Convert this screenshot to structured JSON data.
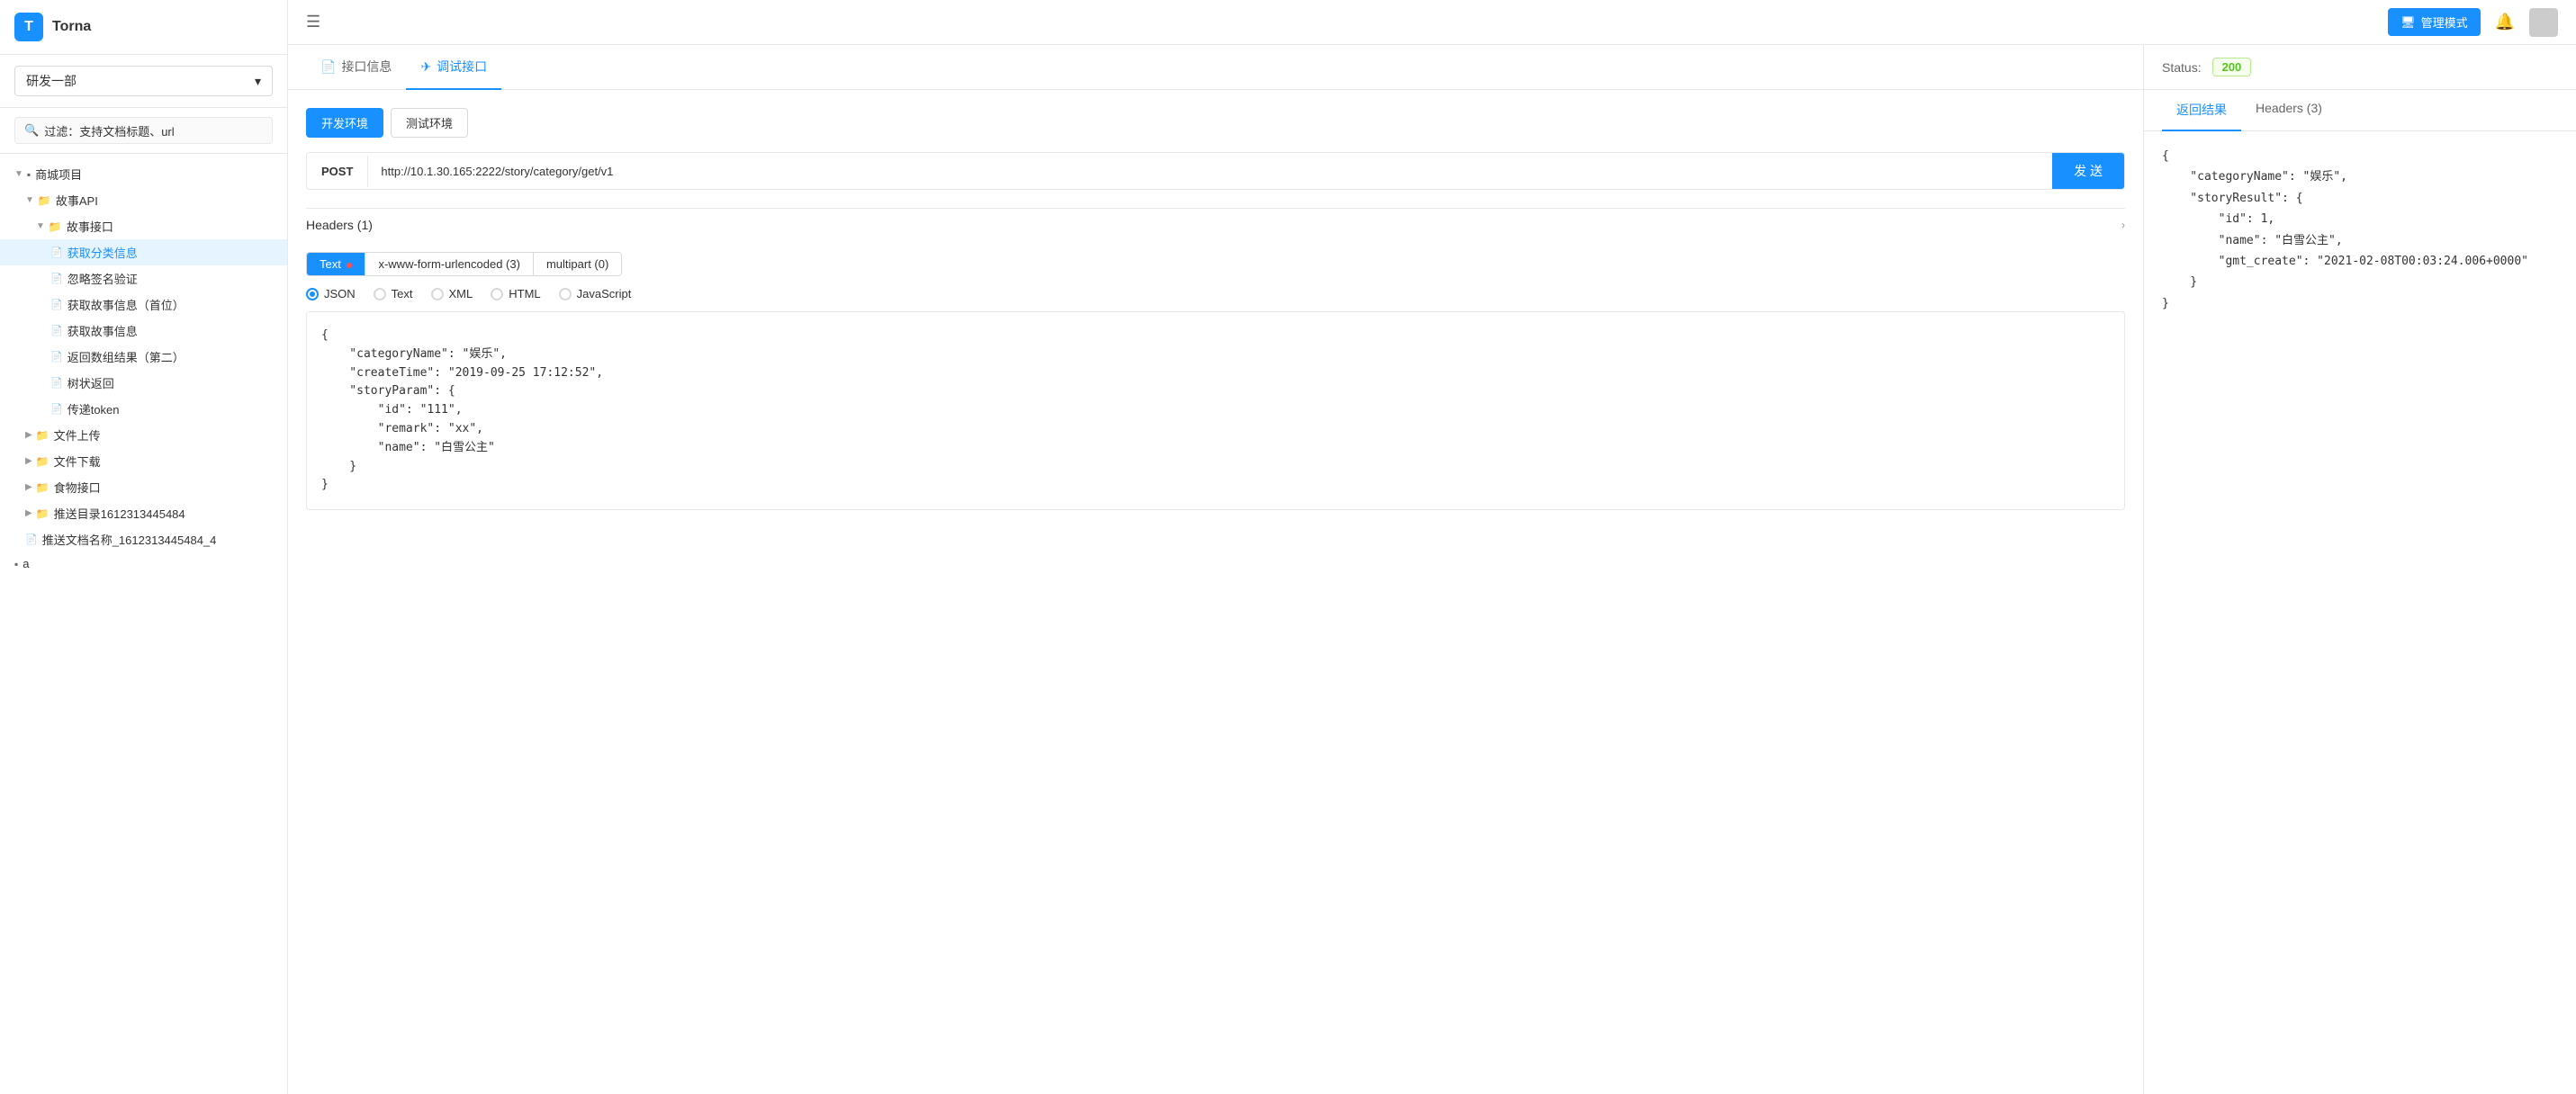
{
  "app": {
    "name": "Torna",
    "logo": "T"
  },
  "sidebar": {
    "dept": "研发一部",
    "search_placeholder": "过滤：支持文档标题、url",
    "tree": [
      {
        "id": "mall",
        "label": "商城项目",
        "level": 0,
        "type": "project",
        "expanded": true,
        "arrow": "▼"
      },
      {
        "id": "story-api",
        "label": "故事API",
        "level": 1,
        "type": "group",
        "expanded": true,
        "arrow": "▼"
      },
      {
        "id": "story-interface",
        "label": "故事接口",
        "level": 2,
        "type": "folder",
        "expanded": true,
        "arrow": "▼"
      },
      {
        "id": "get-category",
        "label": "获取分类信息",
        "level": 3,
        "type": "file",
        "active": true
      },
      {
        "id": "ignore-sign",
        "label": "忽略签名验证",
        "level": 3,
        "type": "file"
      },
      {
        "id": "get-story-first",
        "label": "获取故事信息（首位）",
        "level": 3,
        "type": "file"
      },
      {
        "id": "get-story",
        "label": "获取故事信息",
        "level": 3,
        "type": "file"
      },
      {
        "id": "return-multi",
        "label": "返回数组结果（第二）",
        "level": 3,
        "type": "file"
      },
      {
        "id": "tree-return",
        "label": "树状返回",
        "level": 3,
        "type": "file"
      },
      {
        "id": "pass-token",
        "label": "传递token",
        "level": 3,
        "type": "file"
      },
      {
        "id": "file-upload",
        "label": "文件上传",
        "level": 1,
        "type": "folder",
        "arrow": "▶"
      },
      {
        "id": "file-download",
        "label": "文件下载",
        "level": 1,
        "type": "folder",
        "arrow": "▶"
      },
      {
        "id": "food-interface",
        "label": "食物接口",
        "level": 1,
        "type": "folder",
        "arrow": "▶"
      },
      {
        "id": "push-dir",
        "label": "推送目录1612313445484",
        "level": 1,
        "type": "folder",
        "arrow": "▶"
      },
      {
        "id": "push-doc",
        "label": "推送文档名称_1612313445484_4",
        "level": 1,
        "type": "file"
      },
      {
        "id": "a",
        "label": "a",
        "level": 0,
        "type": "group"
      }
    ]
  },
  "topbar": {
    "mgmt_btn": "管理模式"
  },
  "tabs": [
    {
      "id": "info",
      "label": "接口信息",
      "icon": "📄"
    },
    {
      "id": "debug",
      "label": "调试接口",
      "icon": "✈",
      "active": true
    }
  ],
  "env_buttons": [
    {
      "id": "dev",
      "label": "开发环境",
      "active": true
    },
    {
      "id": "test",
      "label": "测试环境",
      "active": false
    }
  ],
  "request": {
    "method": "POST",
    "url": "http://10.1.30.165:2222/story/category/get/v1",
    "send_btn": "发 送"
  },
  "headers_section": {
    "title": "Headers (1)"
  },
  "body_section": {
    "tabs": [
      {
        "id": "text",
        "label": "Text",
        "active": true,
        "dot": true
      },
      {
        "id": "form",
        "label": "x-www-form-urlencoded (3)"
      },
      {
        "id": "multipart",
        "label": "multipart (0)"
      }
    ],
    "formats": [
      {
        "id": "json",
        "label": "JSON",
        "checked": true
      },
      {
        "id": "text",
        "label": "Text"
      },
      {
        "id": "xml",
        "label": "XML"
      },
      {
        "id": "html",
        "label": "HTML"
      },
      {
        "id": "js",
        "label": "JavaScript"
      }
    ],
    "code": "{\n    \"categoryName\": \"娱乐\",\n    \"createTime\": \"2019-09-25 17:12:52\",\n    \"storyParam\": {\n        \"id\": \"111\",\n        \"remark\": \"xx\",\n        \"name\": \"白雪公主\"\n    }\n}"
  },
  "result": {
    "status_label": "Status:",
    "status_code": "200",
    "tabs": [
      {
        "id": "return",
        "label": "返回结果",
        "active": true
      },
      {
        "id": "headers",
        "label": "Headers (3)"
      }
    ],
    "code": "{\n    \"categoryName\": \"娱乐\",\n    \"storyResult\": {\n        \"id\": 1,\n        \"name\": \"白雪公主\",\n        \"gmt_create\": \"2021-02-08T00:03:24.006+0000\"\n    }\n}"
  }
}
